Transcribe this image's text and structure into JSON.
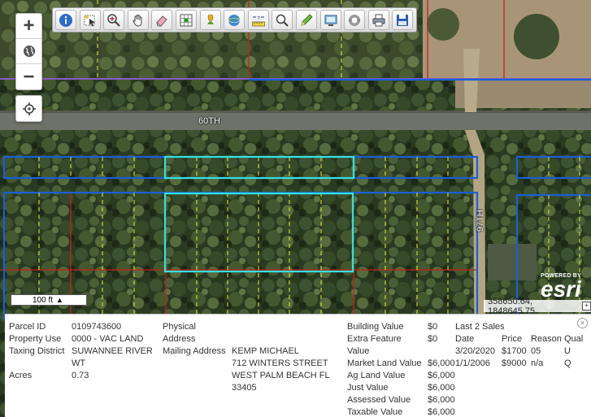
{
  "toolbar": {
    "buttons": [
      {
        "icon": "info-icon"
      },
      {
        "icon": "select-icon"
      },
      {
        "icon": "zoom-in-tool-icon"
      },
      {
        "icon": "pan-hand-icon"
      },
      {
        "icon": "eraser-icon"
      },
      {
        "icon": "grid-select-icon"
      },
      {
        "icon": "pushpin-icon"
      },
      {
        "icon": "globe-icon"
      },
      {
        "icon": "measure-icon"
      },
      {
        "icon": "find-icon"
      },
      {
        "icon": "draw-pencil-icon"
      },
      {
        "icon": "screen-capture-icon"
      },
      {
        "icon": "layers-icon"
      },
      {
        "icon": "print-icon"
      },
      {
        "icon": "save-icon"
      }
    ]
  },
  "zoom": {
    "in_label": "+",
    "out_label": "−"
  },
  "map": {
    "street_60th": "60TH",
    "street_97th": "97TH",
    "scale_label": "100 ft",
    "esri_powered": "POWERED BY",
    "esri_word": "esri",
    "coordinates": "358650.64, 1848645.75"
  },
  "colors": {
    "parcel_selected": "#34e0e0",
    "parcel_line": "#1a5fd6",
    "lot_line": "#d6e03a",
    "section_line": "#c81e1e",
    "road_line": "#8a5ac8"
  },
  "parcel": {
    "parcel_id_label": "Parcel ID",
    "parcel_id_value": "0109743600",
    "property_use_label": "Property Use",
    "property_use_value": "0000 - VAC LAND",
    "taxing_district_label": "Taxing District",
    "taxing_district_value_1": "SUWANNEE RIVER",
    "taxing_district_value_2": "WT",
    "acres_label": "Acres",
    "acres_value": "0.73",
    "physical_address_label_1": "Physical",
    "physical_address_label_2": "Address",
    "mailing_address_label": "Mailing Address",
    "mailing_line_1": "KEMP MICHAEL",
    "mailing_line_2": "712 WINTERS STREET",
    "mailing_line_3": "WEST PALM BEACH FL",
    "mailing_line_4": "33405"
  },
  "values": {
    "building_label": "Building Value",
    "building_value": "$0",
    "extra_label_1": "Extra Feature",
    "extra_label_2": "Value",
    "extra_value": "$0",
    "market_land_label": "Market Land Value",
    "market_land_value": "$6,000",
    "ag_land_label": "Ag Land Value",
    "ag_land_value": "$6,000",
    "just_label": "Just Value",
    "just_value": "$6,000",
    "assessed_label": "Assessed Value",
    "assessed_value": "$6,000",
    "taxable_label": "Taxable Value",
    "taxable_value": "$6,000"
  },
  "sales": {
    "title": "Last 2 Sales",
    "headers": {
      "date": "Date",
      "price": "Price",
      "reason": "Reason",
      "qual": "Qual"
    },
    "rows": [
      {
        "date": "3/20/2020",
        "price": "$1700",
        "reason": "05",
        "qual": "U"
      },
      {
        "date": "1/1/2006",
        "price": "$9000",
        "reason": "n/a",
        "qual": "Q"
      }
    ]
  }
}
